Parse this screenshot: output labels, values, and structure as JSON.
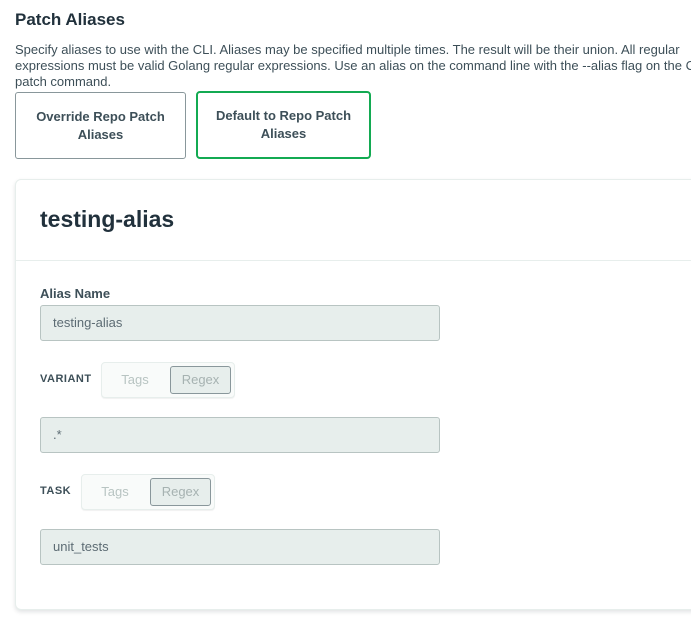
{
  "section": {
    "title": "Patch Aliases",
    "description": "Specify aliases to use with the CLI. Aliases may be specified multiple times. The result will be their union. All regular expressions must be valid Golang regular expressions. Use an alias on the command line with the --alias flag on the CLI patch command."
  },
  "choices": {
    "override": "Override Repo Patch Aliases",
    "default": "Default to Repo Patch Aliases",
    "selected": "default"
  },
  "alias": {
    "title": "testing-alias",
    "name_label": "Alias Name",
    "name_value": "testing-alias",
    "variant": {
      "label": "VARIANT",
      "options": [
        "Tags",
        "Regex"
      ],
      "selected": "Regex",
      "value": ".*"
    },
    "task": {
      "label": "TASK",
      "options": [
        "Tags",
        "Regex"
      ],
      "selected": "Regex",
      "value": "unit_tests"
    }
  },
  "colors": {
    "accent_green": "#13aa52",
    "input_bg": "#e7eeec",
    "heading": "#21313c"
  }
}
